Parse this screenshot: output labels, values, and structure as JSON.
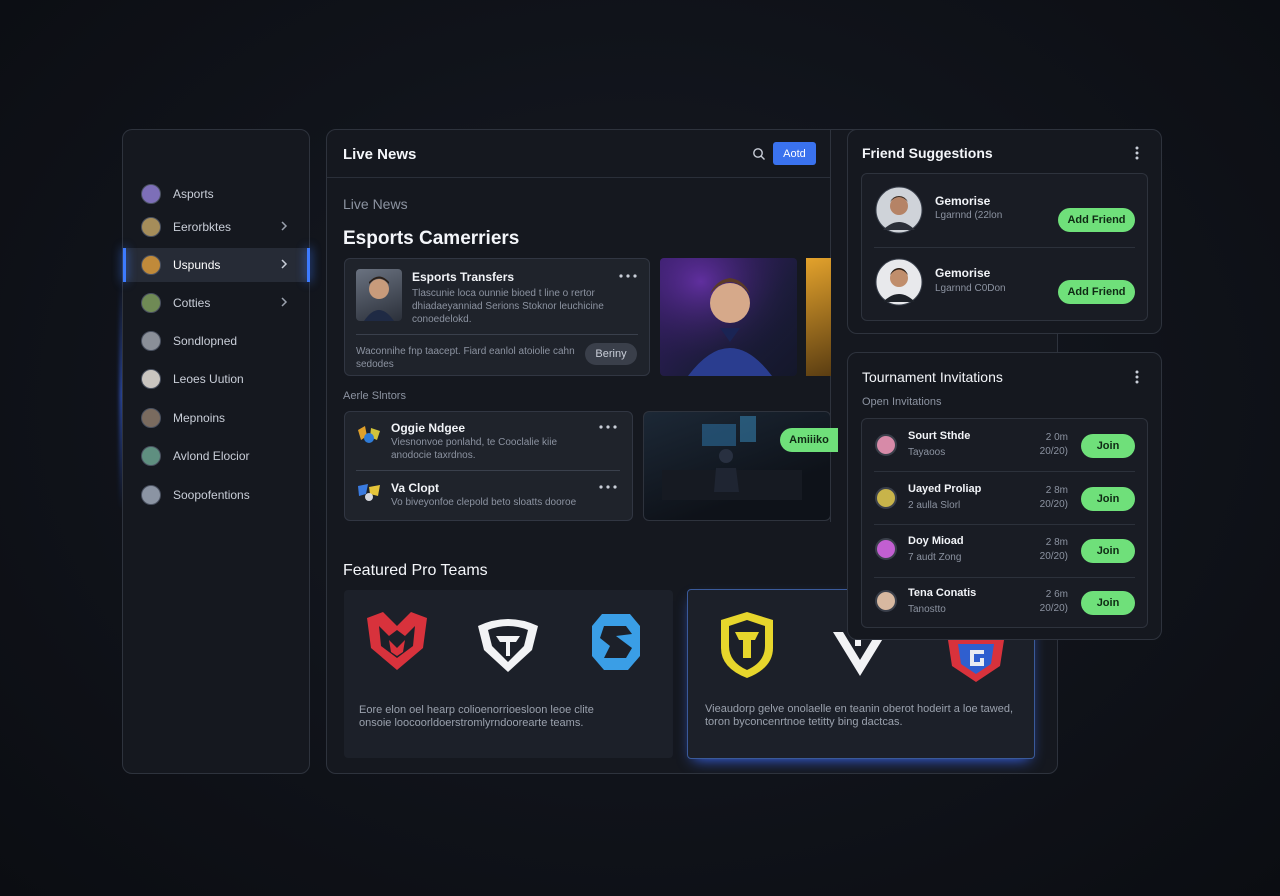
{
  "sidebar": {
    "items": [
      {
        "label": "Asports",
        "chevron": false,
        "active": false,
        "avatar": "#7d6fb8"
      },
      {
        "label": "Eerorbktes",
        "chevron": true,
        "active": false,
        "avatar": "#a58d5a"
      },
      {
        "label": "Uspunds",
        "chevron": true,
        "active": true,
        "avatar": "#c08a3a"
      },
      {
        "label": "Cotties",
        "chevron": true,
        "active": false,
        "avatar": "#6f8a55"
      },
      {
        "label": "Sondlopned",
        "chevron": false,
        "active": false,
        "avatar": "#8a8f98"
      },
      {
        "label": "Leoes Uution",
        "chevron": false,
        "active": false,
        "avatar": "#c9c5c0"
      },
      {
        "label": "Mepnoins",
        "chevron": false,
        "active": false,
        "avatar": "#7a6b5f"
      },
      {
        "label": "Avlond Elocior",
        "chevron": false,
        "active": false,
        "avatar": "#5f8f80"
      },
      {
        "label": "Soopofentions",
        "chevron": false,
        "active": false,
        "avatar": "#8b94a3"
      }
    ]
  },
  "main": {
    "header": {
      "title": "Live News",
      "add_label": "Aotd"
    },
    "section_label": "Live News",
    "heading": "Esports Camerriers",
    "transfer_card": {
      "title": "Esports Transfers",
      "body": "Tlascunie loca ounnie bioed t line o rertor dhiadaeyanniad Serions Stoknor leuchicine conoedelokd.",
      "footer": "Waconnihe fnp taacept. Fiard eanlol atoiolie cahn sedodes",
      "button": "Beriny"
    },
    "subsection_label": "Aerle Slntors",
    "news_items": [
      {
        "title": "Oggie Ndgee",
        "body": "Viesnonvoe ponlahd, te Cooclalie kiie anodocie taxrdnos."
      },
      {
        "title": "Va Clopt",
        "body": "Vo biveyonfoe clepold beto sloatts dooroe"
      }
    ],
    "arena_button": "Amiiiko",
    "featured_title": "Featured Pro Teams",
    "team_cards": [
      {
        "caption": "Eore elon oel hearp colioenorrioesloon leoe clite onsoie loocoorldoerstromlyrndoorearte teams."
      },
      {
        "caption": "Vieaudorp gelve onolaelle en teanin oberot hodeirt a loe tawed, toron byconcenrtnoe tetitty bing dactcas."
      }
    ],
    "team_logos": [
      "red-team-logo",
      "white-shield-logo",
      "blue-team-logo",
      "yellow-crest-logo",
      "white-chevron-logo",
      "red-blue-g-logo"
    ]
  },
  "friends": {
    "title": "Friend Suggestions",
    "items": [
      {
        "name": "Gemorise",
        "meta": "Lgarnnd (22lon",
        "button": "Add Friend"
      },
      {
        "name": "Gemorise",
        "meta": "Lgarnnd C0Don",
        "button": "Add Friend"
      }
    ]
  },
  "tournaments": {
    "title": "Tournament Invitations",
    "subtitle": "Open Invitations",
    "items": [
      {
        "name": "Sourt Sthde",
        "sub": "Tayaoos",
        "time": "2 0m",
        "slots": "20/20)",
        "button": "Join",
        "icon": "#d78aa8"
      },
      {
        "name": "Uayed Proliap",
        "sub": "2 aulla Slorl",
        "time": "2 8m",
        "slots": "20/20)",
        "button": "Join",
        "icon": "#c8b44a"
      },
      {
        "name": "Doy Mioad",
        "sub": "7 audt Zong",
        "time": "2 8m",
        "slots": "20/20)",
        "button": "Join",
        "icon": "#c25fd1"
      },
      {
        "name": "Tena Conatis",
        "sub": "Tanostto",
        "time": "2 6m",
        "slots": "20/20)",
        "button": "Join",
        "icon": "#d7b8a0"
      }
    ]
  },
  "colors": {
    "accent_blue": "#3a72ee",
    "join_green": "#6fe07a",
    "bg": "#10131a"
  }
}
